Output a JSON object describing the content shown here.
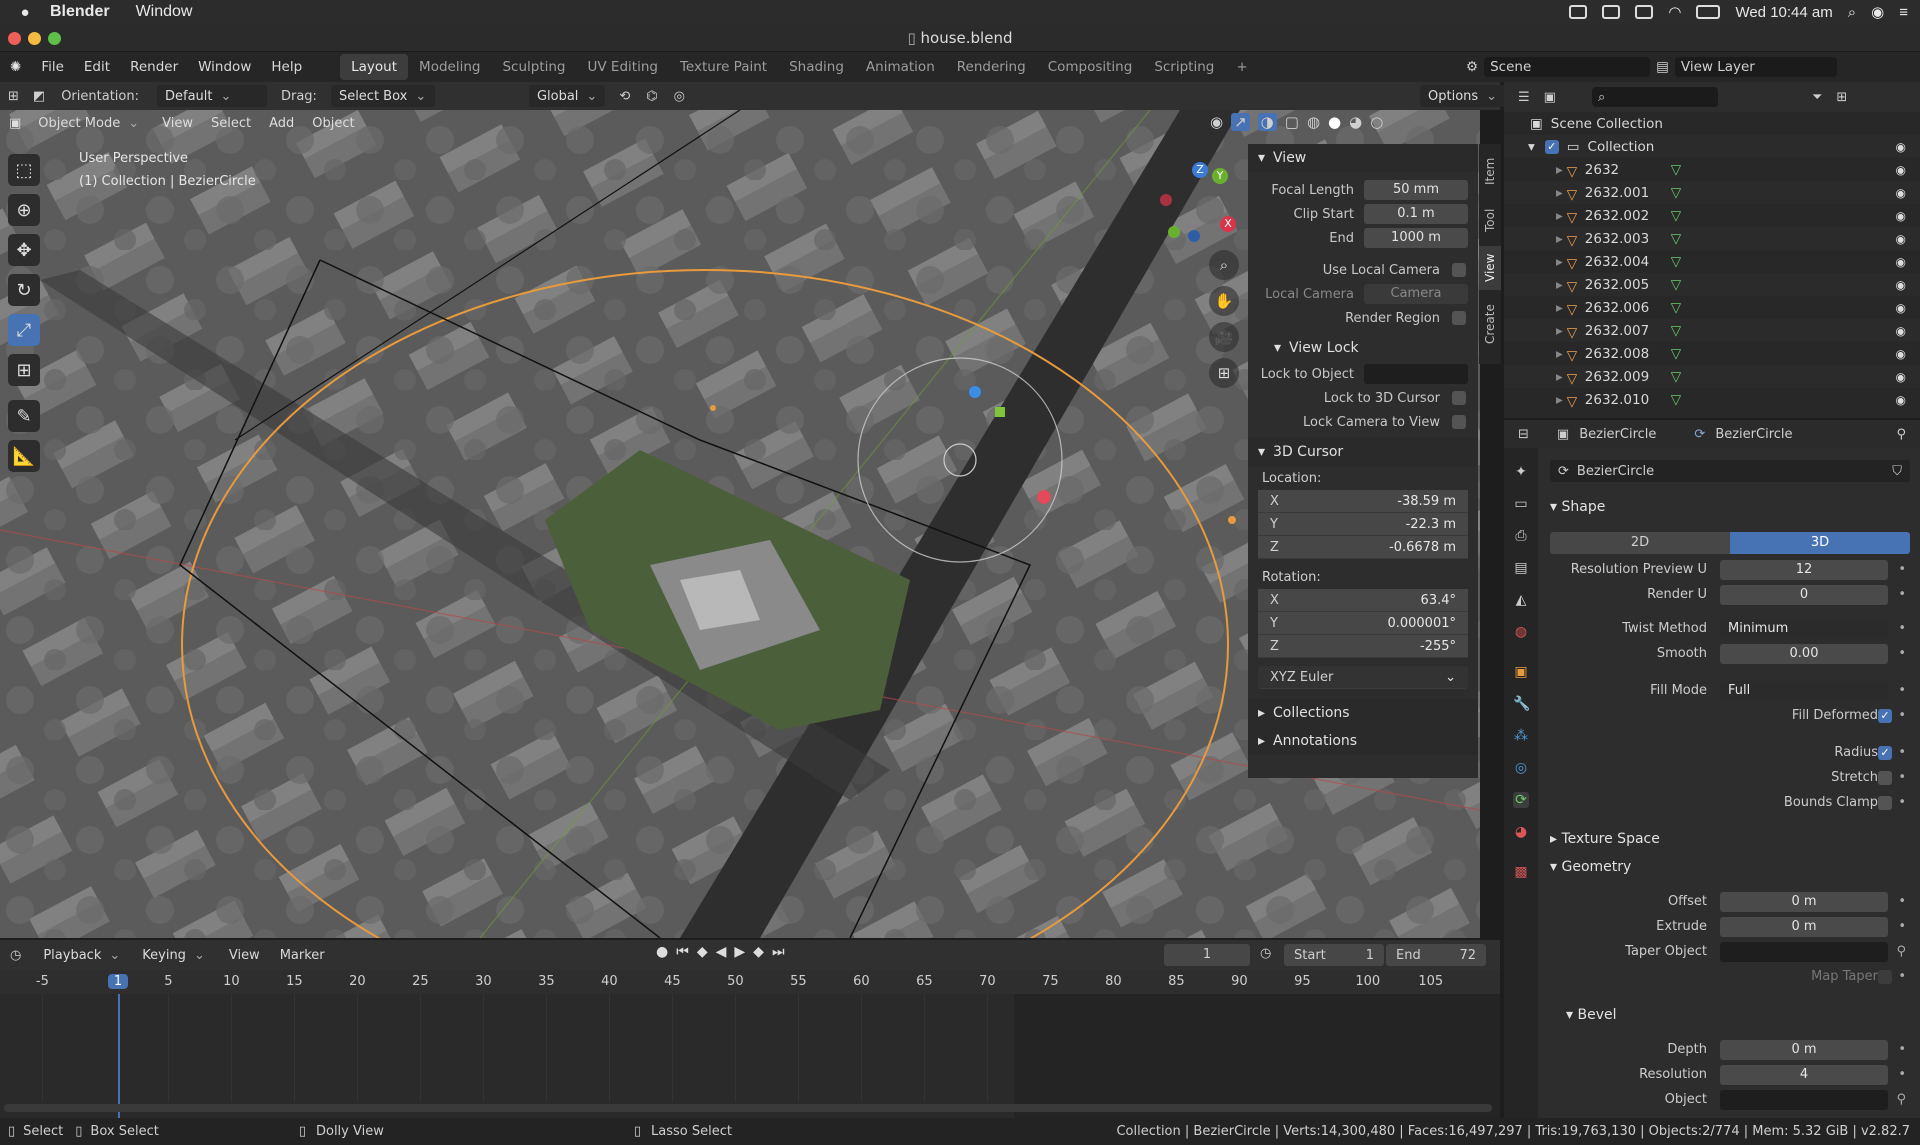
{
  "macbar": {
    "app": "Blender",
    "menu": "Window",
    "datetime": "Wed 10:44 am"
  },
  "title": "house.blend",
  "menu": [
    "File",
    "Edit",
    "Render",
    "Window",
    "Help"
  ],
  "workspaces": [
    "Layout",
    "Modeling",
    "Sculpting",
    "UV Editing",
    "Texture Paint",
    "Shading",
    "Animation",
    "Rendering",
    "Compositing",
    "Scripting"
  ],
  "scene": {
    "label": "Scene",
    "view_layer": "View Layer"
  },
  "toolbar": {
    "orientation_label": "Orientation:",
    "orientation_value": "Default",
    "drag_label": "Drag:",
    "drag_value": "Select Box",
    "transform": "Global",
    "options": "Options"
  },
  "viewport_header": {
    "mode": "Object Mode",
    "items": [
      "View",
      "Select",
      "Add",
      "Object"
    ]
  },
  "viewport_overlay": {
    "perspective": "User Perspective",
    "collection": "(1) Collection | BezierCircle"
  },
  "gizmo": {
    "x": "X",
    "y": "Y",
    "z": "Z"
  },
  "npanel": {
    "tabs": [
      "Item",
      "Tool",
      "View",
      "Create"
    ],
    "view_title": "View",
    "focal_length": {
      "label": "Focal Length",
      "value": "50 mm"
    },
    "clip_start": {
      "label": "Clip Start",
      "value": "0.1 m"
    },
    "clip_end": {
      "label": "End",
      "value": "1000 m"
    },
    "use_local_camera": "Use Local Camera",
    "local_camera": {
      "label": "Local Camera",
      "value": "Camera"
    },
    "render_region": "Render Region",
    "view_lock_title": "View Lock",
    "lock_to_object": "Lock to Object",
    "lock_3d_cursor": "Lock to 3D Cursor",
    "lock_camera": "Lock Camera to View",
    "cursor_title": "3D Cursor",
    "location_label": "Location:",
    "location": [
      {
        "k": "X",
        "v": "-38.59 m"
      },
      {
        "k": "Y",
        "v": "-22.3 m"
      },
      {
        "k": "Z",
        "v": "-0.6678 m"
      }
    ],
    "rotation_label": "Rotation:",
    "rotation": [
      {
        "k": "X",
        "v": "63.4°"
      },
      {
        "k": "Y",
        "v": "0.000001°"
      },
      {
        "k": "Z",
        "v": "-255°"
      }
    ],
    "rotation_mode": "XYZ Euler",
    "collections": "Collections",
    "annotations": "Annotations"
  },
  "outliner": {
    "root": "Scene Collection",
    "collection": "Collection",
    "items": [
      "2632",
      "2632.001",
      "2632.002",
      "2632.003",
      "2632.004",
      "2632.005",
      "2632.006",
      "2632.007",
      "2632.008",
      "2632.009",
      "2632.010"
    ]
  },
  "properties": {
    "breadcrumb_obj": "BezierCircle",
    "breadcrumb_data": "BezierCircle",
    "datablock": "BezierCircle",
    "shape_title": "Shape",
    "mode_2d": "2D",
    "mode_3d": "3D",
    "resolution_preview": {
      "label": "Resolution Preview U",
      "value": "12"
    },
    "render_u": {
      "label": "Render U",
      "value": "0"
    },
    "twist_method": {
      "label": "Twist Method",
      "value": "Minimum"
    },
    "smooth": {
      "label": "Smooth",
      "value": "0.00"
    },
    "fill_mode": {
      "label": "Fill Mode",
      "value": "Full"
    },
    "fill_deformed": "Fill Deformed",
    "radius": "Radius",
    "stretch": "Stretch",
    "bounds_clamp": "Bounds Clamp",
    "texture_space": "Texture Space",
    "geometry": "Geometry",
    "offset": {
      "label": "Offset",
      "value": "0 m"
    },
    "extrude": {
      "label": "Extrude",
      "value": "0 m"
    },
    "taper_object": "Taper Object",
    "map_taper": "Map Taper",
    "bevel": "Bevel",
    "depth": {
      "label": "Depth",
      "value": "0 m"
    },
    "resolution": {
      "label": "Resolution",
      "value": "4"
    },
    "object": "Object"
  },
  "timeline": {
    "menus": [
      "Playback",
      "Keying",
      "View",
      "Marker"
    ],
    "current_frame": "1",
    "start_label": "Start",
    "start": "1",
    "end_label": "End",
    "end": "72",
    "ticks": [
      "-5",
      "1",
      "5",
      "10",
      "15",
      "20",
      "25",
      "30",
      "35",
      "40",
      "45",
      "50",
      "55",
      "60",
      "65",
      "70",
      "75",
      "80",
      "85",
      "90",
      "95",
      "100",
      "105"
    ]
  },
  "status": {
    "select": "Select",
    "box_select": "Box Select",
    "dolly": "Dolly View",
    "lasso": "Lasso Select",
    "stats": "Collection | BezierCircle | Verts:14,300,480 | Faces:16,497,297 | Tris:19,763,130 | Objects:2/774 | Mem: 5.32 GiB | v2.82.7"
  },
  "colors": {
    "accent": "#4772b3",
    "orange": "#f0a04b",
    "panel": "#2d2d2d",
    "viewport": "#575757"
  }
}
